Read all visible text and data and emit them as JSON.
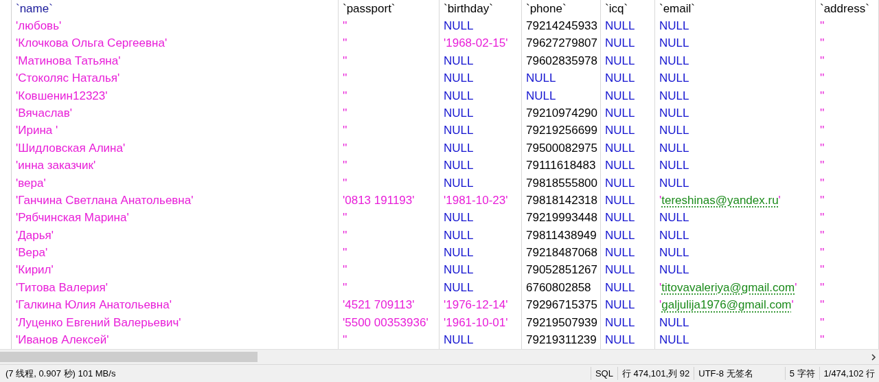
{
  "table": {
    "columns": [
      {
        "label": "`name`",
        "selected": true
      },
      {
        "label": "`passport`",
        "selected": false
      },
      {
        "label": "`birthday`",
        "selected": false
      },
      {
        "label": "`phone`",
        "selected": false
      },
      {
        "label": "`icq`",
        "selected": false
      },
      {
        "label": "`email`",
        "selected": false
      },
      {
        "label": "`address`",
        "selected": false
      }
    ],
    "rows": [
      [
        {
          "kind": "str",
          "text": "'любовь'"
        },
        {
          "kind": "str",
          "text": "''"
        },
        {
          "kind": "null",
          "text": "NULL"
        },
        {
          "kind": "num",
          "text": "79214245933"
        },
        {
          "kind": "null",
          "text": "NULL"
        },
        {
          "kind": "null",
          "text": "NULL"
        },
        {
          "kind": "str",
          "text": "''"
        }
      ],
      [
        {
          "kind": "str",
          "text": "'Клочкова Ольга Сергеевна'"
        },
        {
          "kind": "str",
          "text": "''"
        },
        {
          "kind": "str",
          "text": "'1968-02-15'"
        },
        {
          "kind": "num",
          "text": "79627279807"
        },
        {
          "kind": "null",
          "text": "NULL"
        },
        {
          "kind": "null",
          "text": "NULL"
        },
        {
          "kind": "str",
          "text": "''"
        }
      ],
      [
        {
          "kind": "str",
          "text": "'Матинова Татьяна'"
        },
        {
          "kind": "str",
          "text": "''"
        },
        {
          "kind": "null",
          "text": "NULL"
        },
        {
          "kind": "num",
          "text": "79602835978"
        },
        {
          "kind": "null",
          "text": "NULL"
        },
        {
          "kind": "null",
          "text": "NULL"
        },
        {
          "kind": "str",
          "text": "''"
        }
      ],
      [
        {
          "kind": "str",
          "text": "'Стоколяс Наталья'"
        },
        {
          "kind": "str",
          "text": "''"
        },
        {
          "kind": "null",
          "text": "NULL"
        },
        {
          "kind": "null",
          "text": "NULL"
        },
        {
          "kind": "null",
          "text": "NULL"
        },
        {
          "kind": "null",
          "text": "NULL"
        },
        {
          "kind": "str",
          "text": "''"
        }
      ],
      [
        {
          "kind": "str",
          "text": "'Ковшенин12323'"
        },
        {
          "kind": "str",
          "text": "''"
        },
        {
          "kind": "null",
          "text": "NULL"
        },
        {
          "kind": "null",
          "text": "NULL"
        },
        {
          "kind": "null",
          "text": "NULL"
        },
        {
          "kind": "null",
          "text": "NULL"
        },
        {
          "kind": "str",
          "text": "''"
        }
      ],
      [
        {
          "kind": "str",
          "text": "'Вячаслав'"
        },
        {
          "kind": "str",
          "text": "''"
        },
        {
          "kind": "null",
          "text": "NULL"
        },
        {
          "kind": "num",
          "text": "79210974290"
        },
        {
          "kind": "null",
          "text": "NULL"
        },
        {
          "kind": "null",
          "text": "NULL"
        },
        {
          "kind": "str",
          "text": "''"
        }
      ],
      [
        {
          "kind": "str",
          "text": "'Ирина '"
        },
        {
          "kind": "str",
          "text": "''"
        },
        {
          "kind": "null",
          "text": "NULL"
        },
        {
          "kind": "num",
          "text": "79219256699"
        },
        {
          "kind": "null",
          "text": "NULL"
        },
        {
          "kind": "null",
          "text": "NULL"
        },
        {
          "kind": "str",
          "text": "''"
        }
      ],
      [
        {
          "kind": "str",
          "text": "'Шидловская Алина'"
        },
        {
          "kind": "str",
          "text": "''"
        },
        {
          "kind": "null",
          "text": "NULL"
        },
        {
          "kind": "num",
          "text": "79500082975"
        },
        {
          "kind": "null",
          "text": "NULL"
        },
        {
          "kind": "null",
          "text": "NULL"
        },
        {
          "kind": "str",
          "text": "''"
        }
      ],
      [
        {
          "kind": "str",
          "text": "'инна заказчик'"
        },
        {
          "kind": "str",
          "text": "''"
        },
        {
          "kind": "null",
          "text": "NULL"
        },
        {
          "kind": "num",
          "text": "79111618483"
        },
        {
          "kind": "null",
          "text": "NULL"
        },
        {
          "kind": "null",
          "text": "NULL"
        },
        {
          "kind": "str",
          "text": "''"
        }
      ],
      [
        {
          "kind": "str",
          "text": "'вера'"
        },
        {
          "kind": "str",
          "text": "''"
        },
        {
          "kind": "null",
          "text": "NULL"
        },
        {
          "kind": "num",
          "text": "79818555800"
        },
        {
          "kind": "null",
          "text": "NULL"
        },
        {
          "kind": "null",
          "text": "NULL"
        },
        {
          "kind": "str",
          "text": "''"
        }
      ],
      [
        {
          "kind": "str",
          "text": "'Ганчина Светлана Анатольевна'"
        },
        {
          "kind": "str",
          "text": "'0813 191193'"
        },
        {
          "kind": "str",
          "text": "'1981-10-23'"
        },
        {
          "kind": "num",
          "text": "79818142318"
        },
        {
          "kind": "null",
          "text": "NULL"
        },
        {
          "kind": "email",
          "text": "'tereshinas@yandex.ru'"
        },
        {
          "kind": "str",
          "text": "''"
        }
      ],
      [
        {
          "kind": "str",
          "text": "'Рябчинская Марина'"
        },
        {
          "kind": "str",
          "text": "''"
        },
        {
          "kind": "null",
          "text": "NULL"
        },
        {
          "kind": "num",
          "text": "79219993448"
        },
        {
          "kind": "null",
          "text": "NULL"
        },
        {
          "kind": "null",
          "text": "NULL"
        },
        {
          "kind": "str",
          "text": "''"
        }
      ],
      [
        {
          "kind": "str",
          "text": "'Дарья'"
        },
        {
          "kind": "str",
          "text": "''"
        },
        {
          "kind": "null",
          "text": "NULL"
        },
        {
          "kind": "num",
          "text": "79811438949"
        },
        {
          "kind": "null",
          "text": "NULL"
        },
        {
          "kind": "null",
          "text": "NULL"
        },
        {
          "kind": "str",
          "text": "''"
        }
      ],
      [
        {
          "kind": "str",
          "text": "'Вера'"
        },
        {
          "kind": "str",
          "text": "''"
        },
        {
          "kind": "null",
          "text": "NULL"
        },
        {
          "kind": "num",
          "text": "79218487068"
        },
        {
          "kind": "null",
          "text": "NULL"
        },
        {
          "kind": "null",
          "text": "NULL"
        },
        {
          "kind": "str",
          "text": "''"
        }
      ],
      [
        {
          "kind": "str",
          "text": "'Кирил'"
        },
        {
          "kind": "str",
          "text": "''"
        },
        {
          "kind": "null",
          "text": "NULL"
        },
        {
          "kind": "num",
          "text": "79052851267"
        },
        {
          "kind": "null",
          "text": "NULL"
        },
        {
          "kind": "null",
          "text": "NULL"
        },
        {
          "kind": "str",
          "text": "''"
        }
      ],
      [
        {
          "kind": "str",
          "text": "'Титова Валерия'"
        },
        {
          "kind": "str",
          "text": "''"
        },
        {
          "kind": "null",
          "text": "NULL"
        },
        {
          "kind": "num",
          "text": "6760802858"
        },
        {
          "kind": "null",
          "text": "NULL"
        },
        {
          "kind": "email",
          "text": "'titovavaleriya@gmail.com'"
        },
        {
          "kind": "str",
          "text": "''"
        }
      ],
      [
        {
          "kind": "str",
          "text": "'Галкина Юлия Анатольевна'"
        },
        {
          "kind": "str",
          "text": "'4521 709113'"
        },
        {
          "kind": "str",
          "text": "'1976-12-14'"
        },
        {
          "kind": "num",
          "text": "79296715375"
        },
        {
          "kind": "null",
          "text": "NULL"
        },
        {
          "kind": "email",
          "text": "'galjulija1976@gmail.com'"
        },
        {
          "kind": "str",
          "text": "''"
        }
      ],
      [
        {
          "kind": "str",
          "text": "'Луценко Евгений Валерьевич'"
        },
        {
          "kind": "str",
          "text": "'5500 00353936'"
        },
        {
          "kind": "str",
          "text": "'1961-10-01'"
        },
        {
          "kind": "num",
          "text": "79219507939"
        },
        {
          "kind": "null",
          "text": "NULL"
        },
        {
          "kind": "null",
          "text": "NULL"
        },
        {
          "kind": "str",
          "text": "''"
        }
      ],
      [
        {
          "kind": "str",
          "text": "'Иванов Алексей'"
        },
        {
          "kind": "str",
          "text": "''"
        },
        {
          "kind": "null",
          "text": "NULL"
        },
        {
          "kind": "num",
          "text": "79219311239"
        },
        {
          "kind": "null",
          "text": "NULL"
        },
        {
          "kind": "null",
          "text": "NULL"
        },
        {
          "kind": "str",
          "text": "''"
        }
      ]
    ]
  },
  "status_bar": {
    "message": "(7 线程, 0.907 秒) 101 MB/s",
    "sections": [
      "SQL",
      "行 474,101,列 92",
      "UTF-8 无签名",
      "5 字符",
      "1/474,102 行"
    ]
  }
}
